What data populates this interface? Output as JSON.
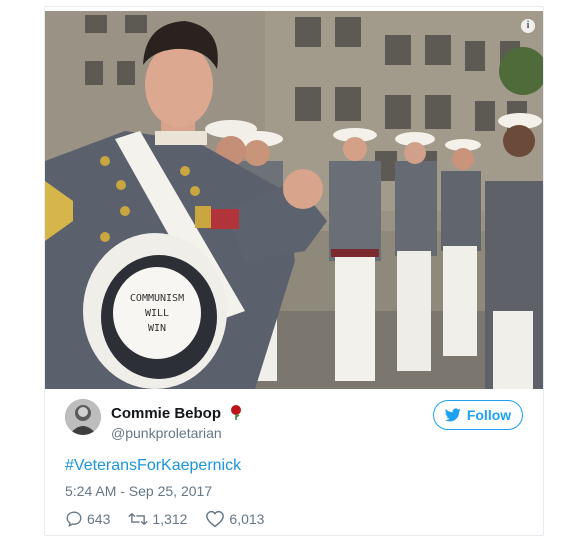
{
  "tweet": {
    "author": {
      "display_name": "Commie Bebop",
      "handle": "@punkproletarian",
      "avatar_icon": "avatar-portrait",
      "badge_icon": "rose-icon"
    },
    "follow_label": "Follow",
    "hashtag": "#VeteransForKaepernick",
    "timestamp": "5:24 AM - Sep 25, 2017",
    "stats": {
      "replies": "643",
      "retweets": "1,312",
      "likes": "6,013"
    },
    "photo": {
      "hat_sign_lines": [
        "COMMUNISM",
        "WILL",
        "WIN"
      ],
      "info_icon": "info-icon"
    }
  },
  "colors": {
    "accent": "#1da1f2",
    "link": "#1b95e0",
    "muted": "#657786",
    "text": "#14171a",
    "rose": "#c0141c"
  }
}
